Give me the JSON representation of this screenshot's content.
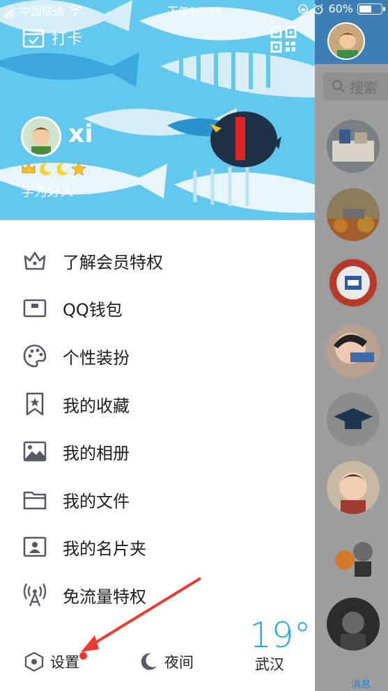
{
  "status_bar": {
    "carrier": "中国联通",
    "time": "下午10:44",
    "battery": "60%",
    "battery_level": 0.6
  },
  "header": {
    "clock_in_label": "打卡",
    "qr_icon": "qr-code-icon",
    "username": "xi",
    "signature": "学为好人",
    "badges": [
      "crown-icon",
      "moon-icon",
      "moon-icon",
      "star-icon"
    ]
  },
  "menu": {
    "items": [
      {
        "label": "了解会员特权",
        "icon": "crown-outline-icon"
      },
      {
        "label": "QQ钱包",
        "icon": "wallet-icon"
      },
      {
        "label": "个性装扮",
        "icon": "palette-icon"
      },
      {
        "label": "我的收藏",
        "icon": "bookmark-star-icon"
      },
      {
        "label": "我的相册",
        "icon": "photo-album-icon"
      },
      {
        "label": "我的文件",
        "icon": "folder-icon"
      },
      {
        "label": "我的名片夹",
        "icon": "contact-card-icon"
      },
      {
        "label": "免流量特权",
        "icon": "signal-tower-icon"
      }
    ]
  },
  "bottom": {
    "settings_label": "设置",
    "night_label": "夜间",
    "temperature": "19°",
    "city": "武汉"
  },
  "right_panel": {
    "search_placeholder": "搜索",
    "tab_label": "消息"
  },
  "colors": {
    "banner_sky": "#62c8ee",
    "accent_blue": "#22a7e8",
    "right_header": "#3d7fb4",
    "annotation_red": "#ef3b2f"
  }
}
